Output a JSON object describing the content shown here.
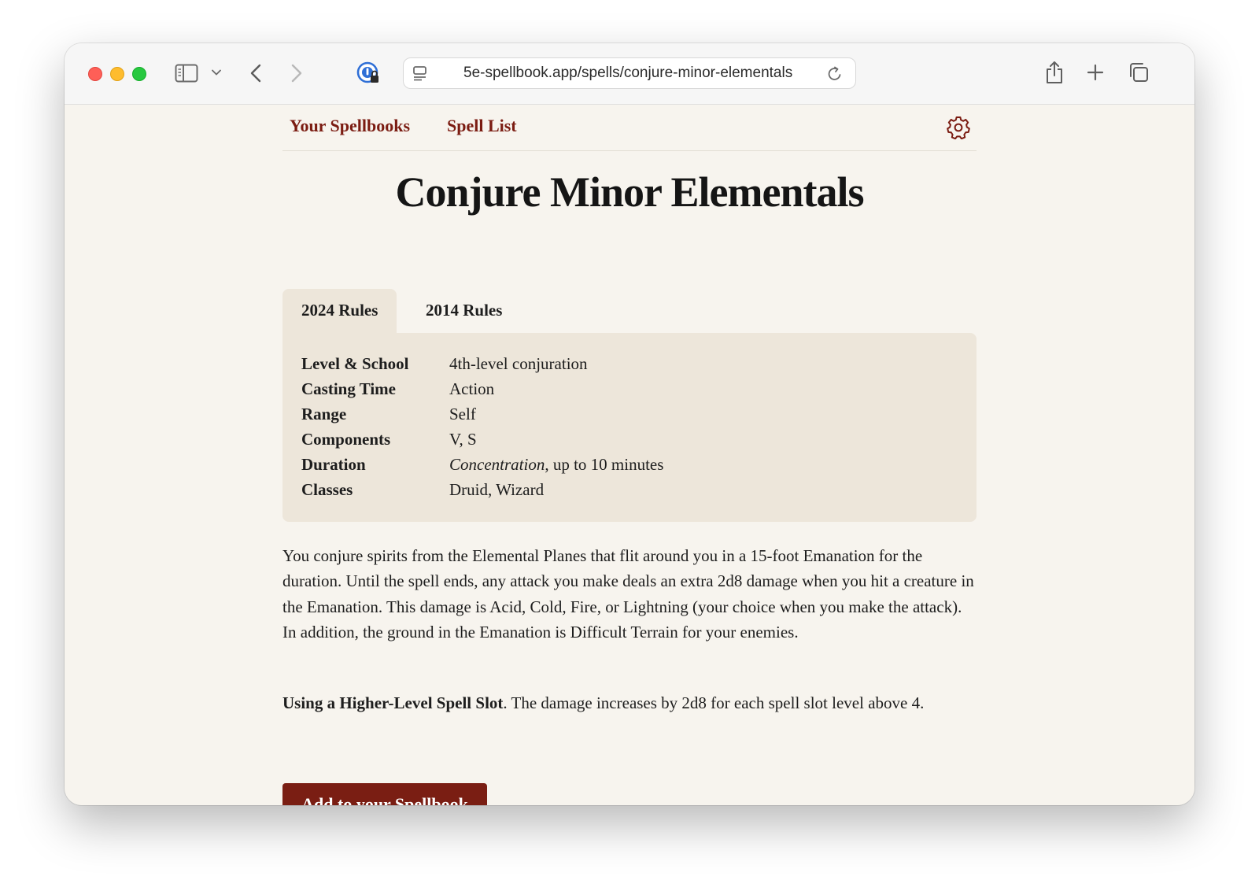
{
  "browser": {
    "url": "5e-spellbook.app/spells/conjure-minor-elementals",
    "icons": [
      "sidebar-icon",
      "chevron-down-icon",
      "back-arrow-icon",
      "forward-arrow-icon",
      "password-manager-icon",
      "site-settings-icon",
      "reload-icon",
      "share-icon",
      "new-tab-icon",
      "tab-overview-icon"
    ]
  },
  "nav": {
    "spellbooks": "Your Spellbooks",
    "spell_list": "Spell List",
    "settings_icon": "gear-icon",
    "accent_color": "#7b1c12"
  },
  "spell": {
    "title": "Conjure Minor Elementals",
    "tabs": [
      {
        "label": "2024 Rules",
        "active": true
      },
      {
        "label": "2014 Rules",
        "active": false
      }
    ],
    "stats": [
      {
        "label": "Level & School",
        "value": "4th-level conjuration"
      },
      {
        "label": "Casting Time",
        "value": "Action"
      },
      {
        "label": "Range",
        "value": "Self"
      },
      {
        "label": "Components",
        "value": "V, S"
      },
      {
        "label": "Duration",
        "value_italic": "Concentration",
        "value": ", up to 10 minutes"
      },
      {
        "label": "Classes",
        "value": "Druid, Wizard"
      }
    ],
    "description": "You conjure spirits from the Elemental Planes that flit around you in a 15-foot Emanation for the duration. Until the spell ends, any attack you make deals an extra 2d8 damage when you hit a creature in the Emanation. This damage is Acid, Cold, Fire, or Lightning (your choice when you make the attack). In addition, the ground in the Emanation is Difficult Terrain for your enemies.",
    "higher_level_label": "Using a Higher-Level Spell Slot",
    "higher_level_text": ". The damage increases by 2d8 for each spell slot level above 4."
  },
  "actions": {
    "add_button": "Add to your Spellbook",
    "button_color": "#7a1e13"
  }
}
